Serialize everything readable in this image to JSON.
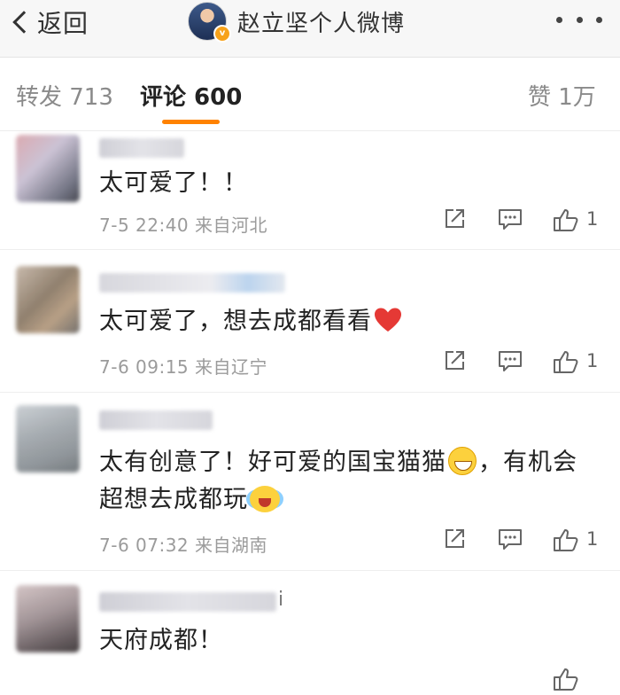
{
  "nav": {
    "back_label": "返回",
    "title": "赵立坚个人微博"
  },
  "tabs": {
    "repost": "转发 713",
    "comments": "评论 600",
    "likes": "赞 1万"
  },
  "colors": {
    "accent": "#ff8200",
    "heart": "#e53935",
    "verified_badge": "#f7a21b"
  },
  "comments": [
    {
      "text": "太可爱了！！",
      "time": "7-5 22:40",
      "source": "来自河北",
      "likes": "1"
    },
    {
      "text_before": "太可爱了，想去成都看看",
      "emoji": "heart",
      "time": "7-6 09:15",
      "source": "来自辽宁",
      "likes": "1"
    },
    {
      "text_part1": "太有创意了！好可爱的国宝猫猫",
      "emoji1": "grin",
      "text_part2": "，有机会超想去成都玩",
      "emoji2": "crying-happy",
      "time": "7-6 07:32",
      "source": "来自湖南",
      "likes": "1"
    },
    {
      "nickname_suffix": "i",
      "text": "天府成都！"
    }
  ],
  "icons": {
    "back": "chevron-left-icon",
    "more": "more-dots-icon",
    "share": "share-icon",
    "reply": "comment-icon",
    "like": "thumbs-up-icon"
  }
}
